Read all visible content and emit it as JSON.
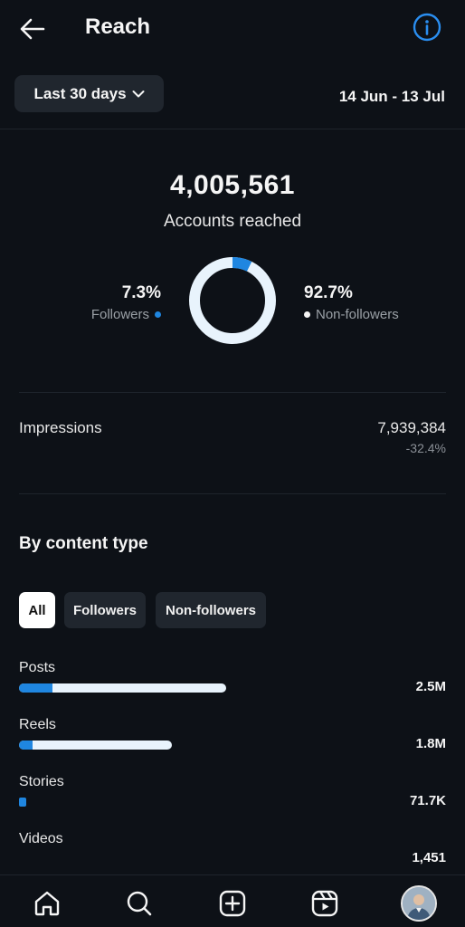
{
  "header": {
    "title": "Reach"
  },
  "range": {
    "label": "Last 30 days",
    "dates": "14 Jun - 13 Jul"
  },
  "reach": {
    "value": "4,005,561",
    "label": "Accounts reached",
    "followers_pct": "7.3%",
    "followers_label": "Followers",
    "nonfollowers_pct": "92.7%",
    "nonfollowers_label": "Non-followers",
    "followers_share": 0.073
  },
  "impressions": {
    "label": "Impressions",
    "value": "7,939,384",
    "change": "-32.4%"
  },
  "content_type": {
    "title": "By content type",
    "filters": [
      "All",
      "Followers",
      "Non-followers"
    ],
    "active_filter": "All",
    "items": [
      {
        "label": "Posts",
        "value": "2.5M",
        "total_share": 1.0,
        "follower_share": 0.16
      },
      {
        "label": "Reels",
        "value": "1.8M",
        "total_share": 0.74,
        "follower_share": 0.09
      },
      {
        "label": "Stories",
        "value": "71.7K",
        "total_share": 0.03,
        "follower_share": 1.0
      },
      {
        "label": "Videos",
        "value": "1,451"
      }
    ]
  },
  "colors": {
    "accent": "#1f86e0",
    "background": "#0d1117",
    "bar_track": "#e8f3fc",
    "chip": "#20262e"
  },
  "icons": [
    "back-arrow-icon",
    "info-icon",
    "chevron-down-icon",
    "home-icon",
    "search-icon",
    "create-icon",
    "reels-icon",
    "profile-avatar"
  ]
}
